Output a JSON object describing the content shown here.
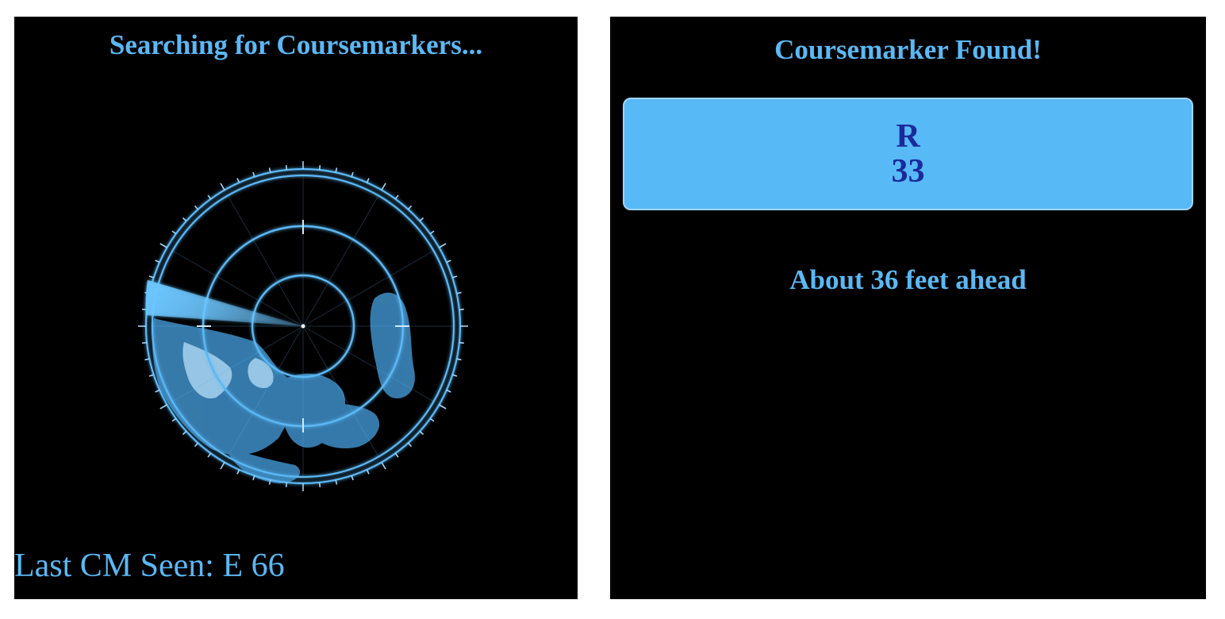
{
  "left_panel": {
    "title": "Searching for Coursemarkers...",
    "last_seen": "Last CM Seen: E 66",
    "radar_icon": "radar-sweep-icon"
  },
  "right_panel": {
    "title": "Coursemarker Found!",
    "marker": {
      "letter": "R",
      "number": "33"
    },
    "distance_text": "About 36 feet ahead"
  },
  "colors": {
    "background": "#000000",
    "accent": "#5bb8f5",
    "card": "#58b9f7",
    "card_text": "#1a2a9a"
  }
}
